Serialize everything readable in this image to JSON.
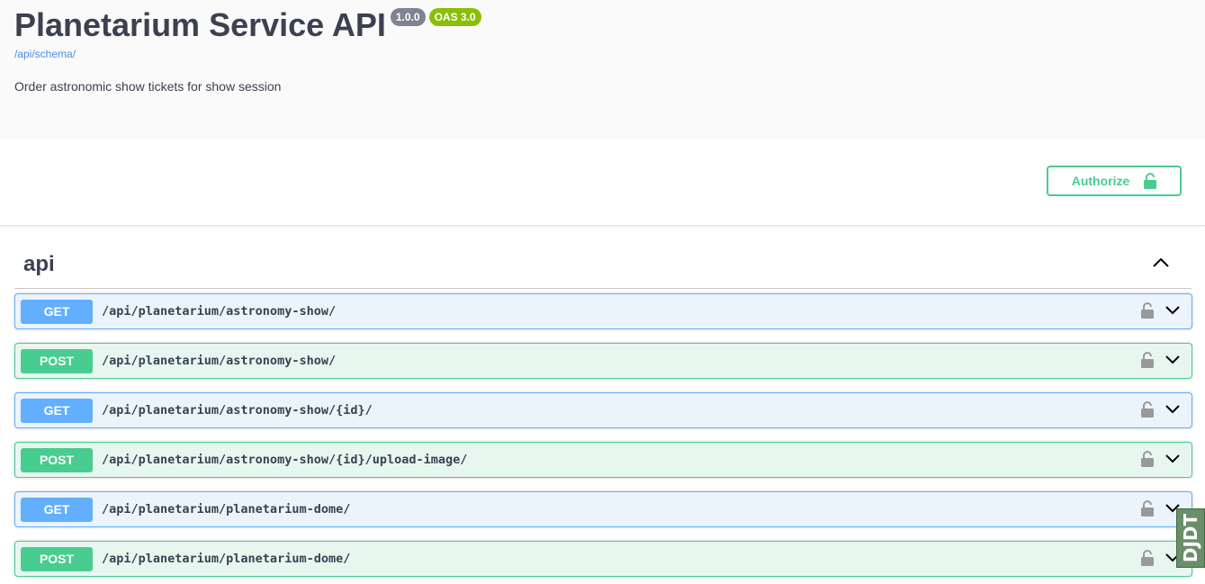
{
  "info": {
    "title": "Planetarium Service API",
    "version_badge": "1.0.0",
    "oas_badge": "OAS 3.0",
    "schema_link": "/api/schema/",
    "description": "Order astronomic show tickets for show session"
  },
  "authorize": {
    "label": "Authorize",
    "icon": "unlocked-lock-icon"
  },
  "tag": {
    "name": "api",
    "icon": "chevron-up-icon"
  },
  "operations": [
    {
      "method": "GET",
      "path": "/api/planetarium/astronomy-show/"
    },
    {
      "method": "POST",
      "path": "/api/planetarium/astronomy-show/"
    },
    {
      "method": "GET",
      "path": "/api/planetarium/astronomy-show/{id}/"
    },
    {
      "method": "POST",
      "path": "/api/planetarium/astronomy-show/{id}/upload-image/"
    },
    {
      "method": "GET",
      "path": "/api/planetarium/planetarium-dome/"
    },
    {
      "method": "POST",
      "path": "/api/planetarium/planetarium-dome/"
    }
  ],
  "debug_toolbar": {
    "label": "DJDT"
  },
  "colors": {
    "get": "#61affe",
    "post": "#49cc90",
    "text": "#3b4151"
  }
}
